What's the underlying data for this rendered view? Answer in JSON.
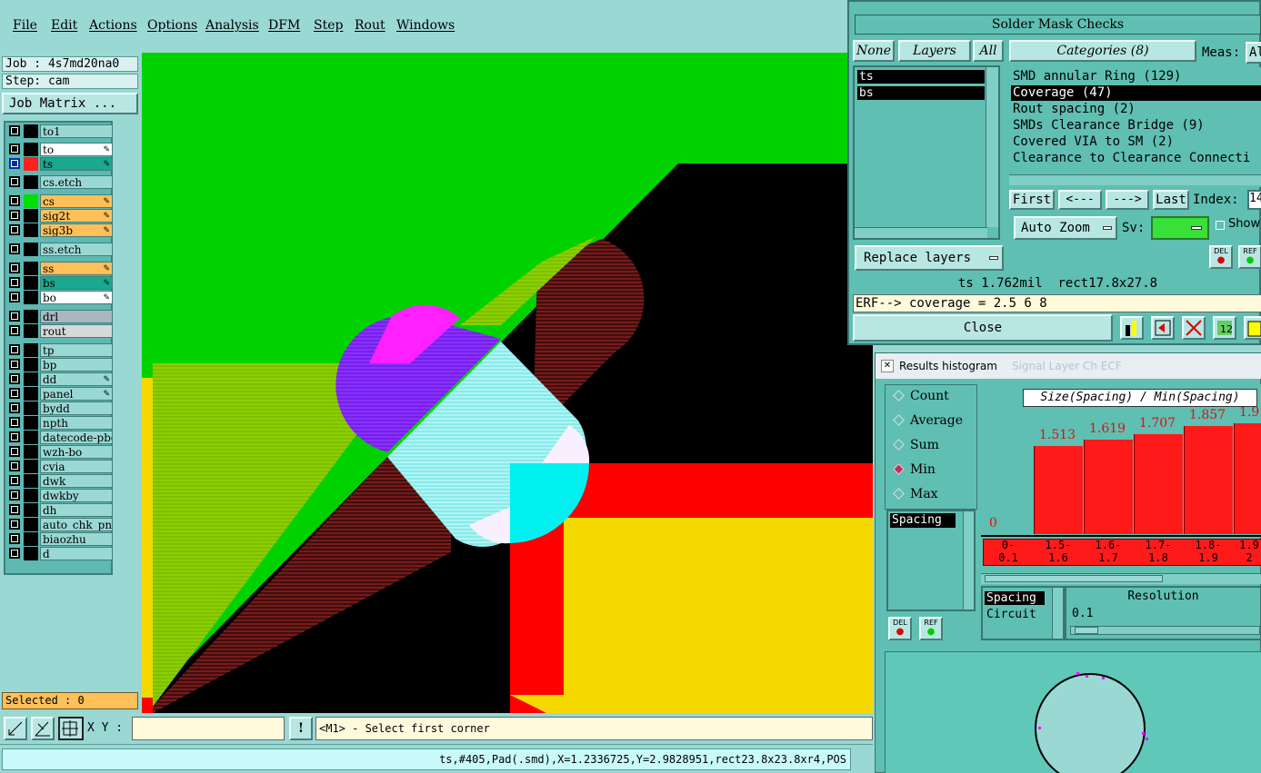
{
  "menu": [
    "File",
    "Edit",
    "Actions",
    "Options",
    "Analysis",
    "DFM",
    "Step",
    "Rout",
    "Windows"
  ],
  "left": {
    "job": "Job : 4s7md20na0",
    "step": "Step: cam",
    "job_matrix": "Job Matrix ...",
    "layers": [
      {
        "name": "to1",
        "bg": "#9ad8d4",
        "swatch": "#000000"
      },
      {
        "name": "to",
        "bg": "#ffffff",
        "swatch": "#000000",
        "edit": true
      },
      {
        "name": "ts",
        "bg": "#1aa88e",
        "swatch": "#ff2020",
        "edit": true,
        "active": true
      },
      {
        "name": "cs.etch",
        "bg": "#9ad8d4",
        "swatch": "#000000"
      },
      {
        "name": "cs",
        "bg": "#ffc05a",
        "swatch": "#00e000",
        "edit": true
      },
      {
        "name": "sig2t",
        "bg": "#ffc05a",
        "swatch": "#000000",
        "edit": true
      },
      {
        "name": "sig3b",
        "bg": "#ffc05a",
        "swatch": "#000000",
        "edit": true
      },
      {
        "name": "ss.etch",
        "bg": "#9ad8d4",
        "swatch": "#000000"
      },
      {
        "name": "ss",
        "bg": "#ffc05a",
        "swatch": "#000000",
        "edit": true
      },
      {
        "name": "bs",
        "bg": "#1aa88e",
        "swatch": "#000000",
        "edit": true
      },
      {
        "name": "bo",
        "bg": "#ffffff",
        "swatch": "#000000",
        "edit": true
      },
      {
        "name": "drl",
        "bg": "#a9b8c0",
        "swatch": "#000000"
      },
      {
        "name": "rout",
        "bg": "#d8d8d8",
        "swatch": "#000000"
      },
      {
        "name": "tp",
        "bg": "#9ad8d4",
        "swatch": "#000000"
      },
      {
        "name": "bp",
        "bg": "#9ad8d4",
        "swatch": "#000000"
      },
      {
        "name": "dd",
        "bg": "#9ad8d4",
        "swatch": "#000000",
        "edit": true
      },
      {
        "name": "panel",
        "bg": "#9ad8d4",
        "swatch": "#000000",
        "edit": true
      },
      {
        "name": "bydd",
        "bg": "#9ad8d4",
        "swatch": "#000000"
      },
      {
        "name": "npth",
        "bg": "#9ad8d4",
        "swatch": "#000000"
      },
      {
        "name": "datecode-pbo",
        "bg": "#9ad8d4",
        "swatch": "#000000"
      },
      {
        "name": "wzh-bo",
        "bg": "#9ad8d4",
        "swatch": "#000000"
      },
      {
        "name": "cvia",
        "bg": "#9ad8d4",
        "swatch": "#000000"
      },
      {
        "name": "dwk",
        "bg": "#9ad8d4",
        "swatch": "#000000"
      },
      {
        "name": "dwkby",
        "bg": "#9ad8d4",
        "swatch": "#000000"
      },
      {
        "name": "dh",
        "bg": "#9ad8d4",
        "swatch": "#000000"
      },
      {
        "name": "auto_chk_pnl",
        "bg": "#9ad8d4",
        "swatch": "#000000"
      },
      {
        "name": "biaozhu",
        "bg": "#9ad8d4",
        "swatch": "#000000"
      },
      {
        "name": "d",
        "bg": "#9ad8d4",
        "swatch": "#000000"
      }
    ],
    "selected": "Selected : 0"
  },
  "bottom": {
    "xy_label": "X Y :",
    "xy_value": "",
    "prompt": "<M1> - Select first corner",
    "status": "ts,#405,Pad(.smd),X=1.2336725,Y=2.9828951,rect23.8x23.8xr4,POS"
  },
  "smc": {
    "title": "Solder Mask Checks",
    "none": "None",
    "layers_label": "Layers",
    "all": "All",
    "layer_items": [
      "ts",
      "bs"
    ],
    "categories_label": "Categories (8)",
    "meas_label": "Meas:",
    "meas_value": "Al",
    "categories": [
      "SMD annular Ring (129)",
      "Coverage (47)",
      "Rout spacing (2)",
      "SMDs Clearance Bridge (9)",
      "Covered VIA to SM (2)",
      "Clearance to Clearance Connecti"
    ],
    "selected_category": 1,
    "first": "First",
    "prev": "<---",
    "next": "--->",
    "last": "Last",
    "index_label": "Index:",
    "index_value": "14",
    "auto_zoom": "Auto Zoom",
    "sv_label": "Sv:",
    "show_label": "Show",
    "replace_layers": "Replace layers",
    "del_label": "DEL",
    "ref_label": "REF",
    "info": "ts 1.762mil  rect17.8x27.8",
    "erf": "ERF--> coverage = 2.5 6 8",
    "close": "Close"
  },
  "hist": {
    "title": "Results histogram",
    "bg_title": "Signal Layer Ch ECF",
    "options": [
      "Count",
      "Average",
      "Sum",
      "Min",
      "Max"
    ],
    "selected_option": 3,
    "chart_title": "Size(Spacing) / Min(Spacing)",
    "left_list": [
      "Spacing"
    ],
    "del_label": "DEL",
    "ref_label": "REF",
    "bottom_list": [
      "Spacing",
      "Circuit"
    ],
    "resolution_label": "Resolution",
    "resolution_value": "0.1"
  },
  "chart_data": {
    "type": "bar",
    "title": "Size(Spacing) / Min(Spacing)",
    "categories": [
      "0-0.1",
      "1.5-1.6",
      "1.6-1.7",
      "1.7-1.8",
      "1.8-1.9",
      "1.9-2"
    ],
    "bin_lines": [
      [
        "0-",
        "0.1"
      ],
      [
        "1.5-",
        "1.6"
      ],
      [
        "1.6-",
        "1.7"
      ],
      [
        "1.7-",
        "1.8"
      ],
      [
        "1.8-",
        "1.9"
      ],
      [
        "1.9",
        "2"
      ]
    ],
    "values": [
      0,
      1.513,
      1.619,
      1.707,
      1.857,
      1.9
    ],
    "labels": [
      "0",
      "1.513",
      "1.619",
      "1.707",
      "1.857",
      "1.9"
    ],
    "ylim": [
      0,
      2.3
    ],
    "color": "#ff1a1a"
  },
  "colors": {
    "panel_bg": "#9ad8d4",
    "window_bg": "#5fbfb2",
    "green": "#00d200",
    "red": "#ff0000",
    "yellow": "#f5d800",
    "cyan": "#00f0f0",
    "magenta": "#ff20ff"
  }
}
